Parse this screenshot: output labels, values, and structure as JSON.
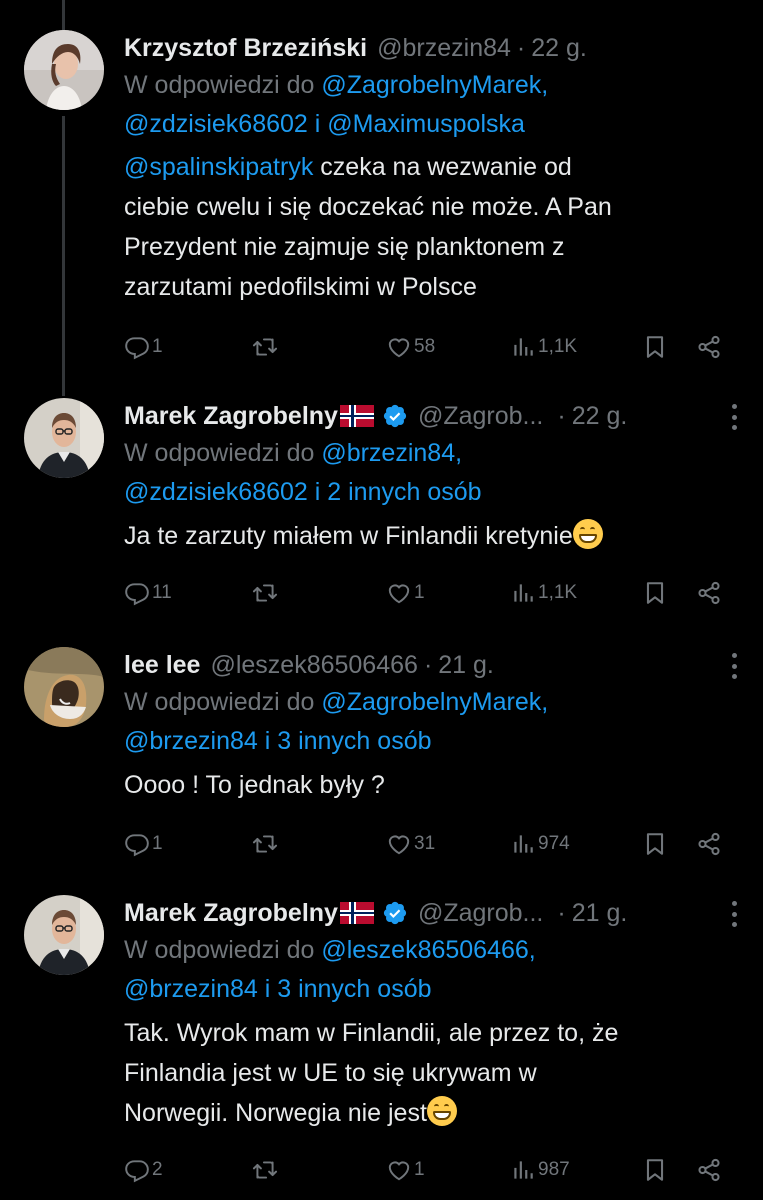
{
  "tweets": [
    {
      "name": "Krzysztof Brzeziński",
      "handle": "@brzezin84",
      "time": "22 g.",
      "reply_prefix": "W odpowiedzi do ",
      "reply_line1_link": "@ZagrobelnyMarek,",
      "reply_line2": "@zdzisiek68602 i @Maximuspolska",
      "text_mention": "@spalinskipatryk",
      "text_line1_rest": " czeka na wezwanie od",
      "text_line2": "ciebie cwelu i się doczekać nie może. A Pan",
      "text_line3": "Prezydent nie zajmuje się planktonem z",
      "text_line4": "zarzutami pedofilskimi w Polsce",
      "replies": "1",
      "likes": "58",
      "views": "1,1K"
    },
    {
      "name": "Marek Zagrobelny",
      "handle": "@Zagrob...",
      "time": "22 g.",
      "reply_prefix": "W odpowiedzi do ",
      "reply_line1_link": "@brzezin84,",
      "reply_line2": "@zdzisiek68602 i 2 innych osób",
      "text_line1": "Ja te zarzuty miałem w Finlandii kretynie",
      "replies": "11",
      "likes": "1",
      "views": "1,1K"
    },
    {
      "name": "lee lee",
      "handle": "@leszek86506466",
      "time": "21 g.",
      "reply_prefix": "W odpowiedzi do ",
      "reply_line1_link": "@ZagrobelnyMarek,",
      "reply_line2": "@brzezin84 i 3 innych osób",
      "text_line1": "Oooo ! To jednak były ?",
      "replies": "1",
      "likes": "31",
      "views": "974"
    },
    {
      "name": "Marek Zagrobelny",
      "handle": "@Zagrob...",
      "time": "21 g.",
      "reply_prefix": "W odpowiedzi do ",
      "reply_line1_link": "@leszek86506466,",
      "reply_line2": "@brzezin84 i 3 innych osób",
      "text_line1": "Tak. Wyrok mam w Finlandii, ale przez to, że",
      "text_line2": "Finlandia jest w UE to się ukrywam w",
      "text_line3": "Norwegii. Norwegia nie jest",
      "replies": "2",
      "likes": "1",
      "views": "987"
    }
  ],
  "colors": {
    "background": "#000000",
    "text": "#e7e9ea",
    "muted": "#71767b",
    "link": "#1d9bf0",
    "verified": "#1d9bf0"
  },
  "icons": [
    "reply-icon",
    "retweet-icon",
    "like-icon",
    "views-icon",
    "bookmark-icon",
    "share-icon",
    "more-icon",
    "verified-icon",
    "norway-flag-icon",
    "grin-emoji-icon"
  ]
}
